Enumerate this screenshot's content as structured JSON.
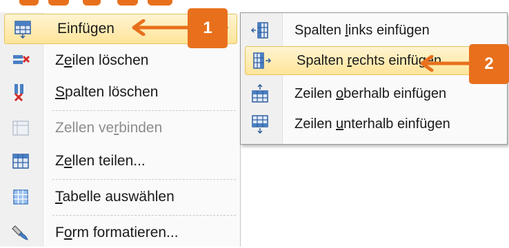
{
  "colors": {
    "accent": "#e8701c",
    "highlight": "#ffe59a",
    "disabled_text": "#8d8d8d"
  },
  "menu": {
    "items": [
      {
        "pre": "Einfü",
        "acc": "g",
        "post": "en",
        "icon": "insert-table-icon",
        "state": "highlighted",
        "has_submenu": true
      },
      {
        "pre": "Z",
        "acc": "e",
        "post": "ilen löschen",
        "icon": "delete-rows-icon",
        "state": "enabled"
      },
      {
        "pre": "",
        "acc": "S",
        "post": "palten löschen",
        "icon": "delete-columns-icon",
        "state": "enabled"
      },
      {
        "pre": "Zellen ve",
        "acc": "r",
        "post": "binden",
        "icon": "merge-cells-icon",
        "state": "disabled"
      },
      {
        "pre": "Z",
        "acc": "e",
        "post": "llen teilen...",
        "icon": "split-cells-icon",
        "state": "enabled"
      },
      {
        "pre": "",
        "acc": "T",
        "post": "abelle auswählen",
        "icon": "select-table-icon",
        "state": "enabled"
      },
      {
        "pre": "F",
        "acc": "o",
        "post": "rm formatieren...",
        "icon": "format-shape-icon",
        "state": "enabled"
      }
    ]
  },
  "submenu": {
    "items": [
      {
        "pre": "Spalten ",
        "acc": "l",
        "post": "inks einfügen",
        "icon": "insert-column-left-icon",
        "state": "enabled"
      },
      {
        "pre": "Spalten ",
        "acc": "r",
        "post": "echts einfügen",
        "icon": "insert-column-right-icon",
        "state": "highlighted"
      },
      {
        "pre": "Zeilen ",
        "acc": "o",
        "post": "berhalb einfügen",
        "icon": "insert-row-above-icon",
        "state": "enabled"
      },
      {
        "pre": "Zeilen ",
        "acc": "u",
        "post": "nterhalb einfügen",
        "icon": "insert-row-below-icon",
        "state": "enabled"
      }
    ]
  },
  "callouts": [
    {
      "label": "1"
    },
    {
      "label": "2"
    }
  ]
}
